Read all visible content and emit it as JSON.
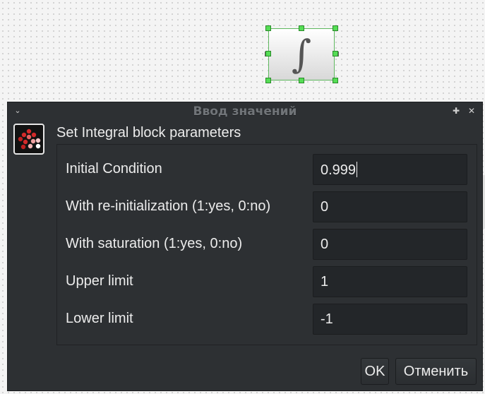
{
  "diagram": {
    "block_symbol": "∫"
  },
  "dialog": {
    "title": "Ввод значений",
    "heading": "Set Integral block parameters",
    "params": [
      {
        "label": "Initial Condition",
        "value": "0.999"
      },
      {
        "label": "With re-initialization (1:yes, 0:no)",
        "value": "0"
      },
      {
        "label": "With saturation (1:yes, 0:no)",
        "value": "0"
      },
      {
        "label": "Upper limit",
        "value": "1"
      },
      {
        "label": "Lower limit",
        "value": "-1"
      }
    ],
    "ok_label": "OK",
    "cancel_label": "Отменить"
  }
}
